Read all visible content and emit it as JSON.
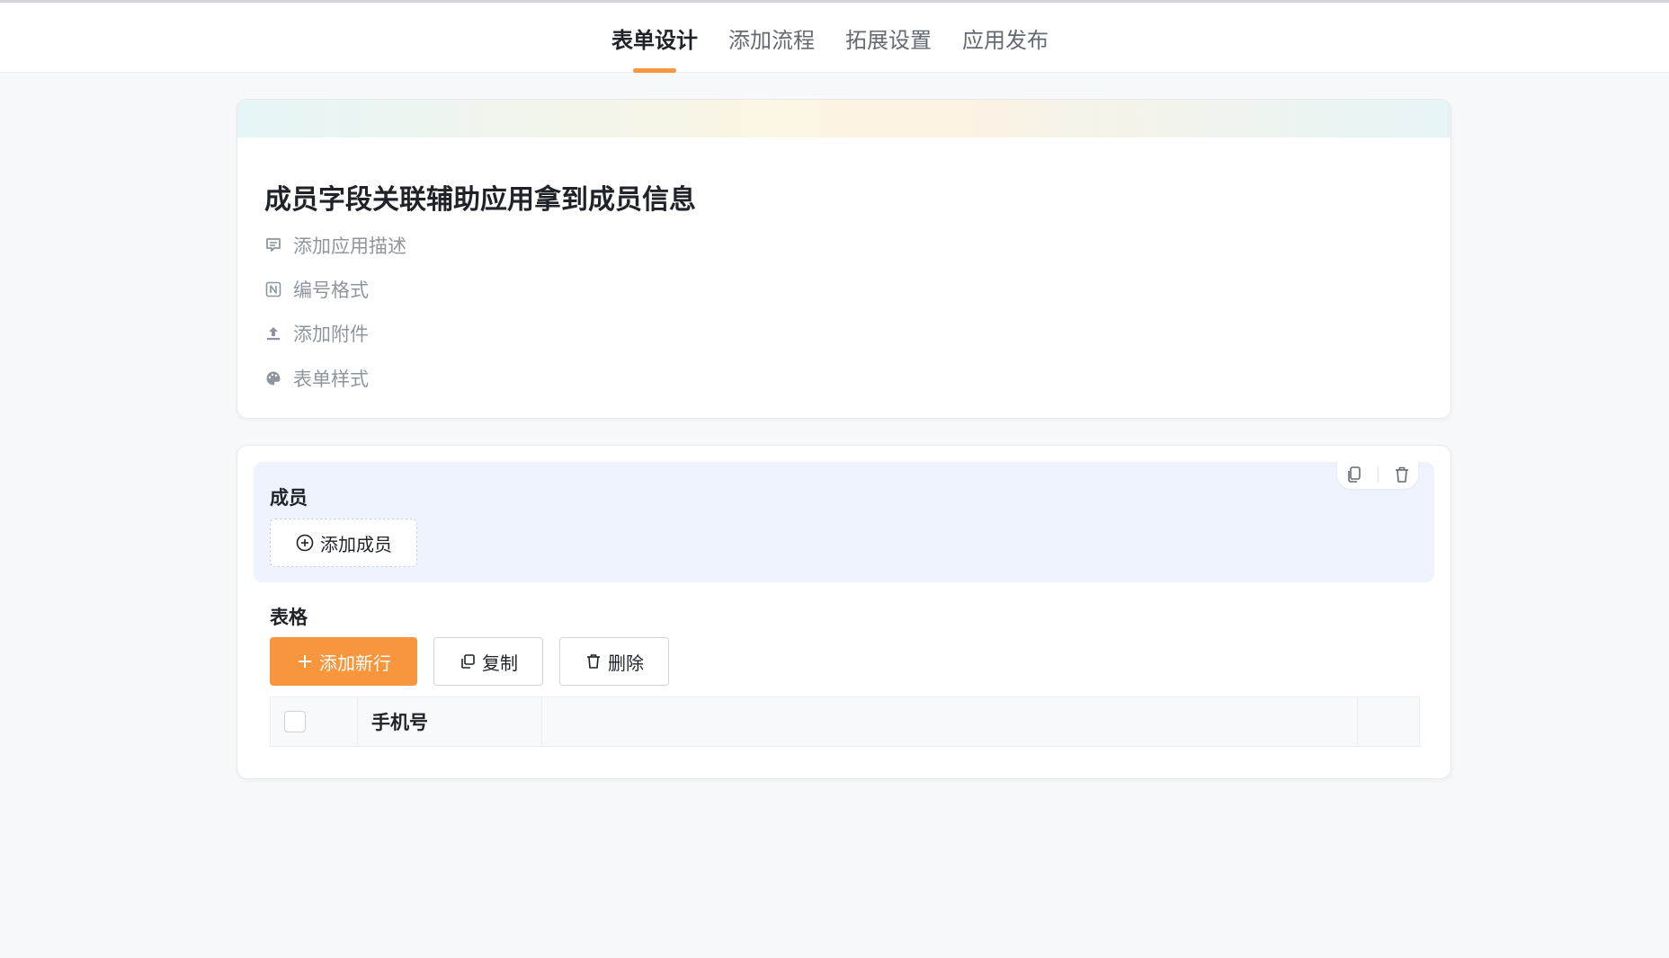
{
  "header": {
    "tabs": [
      {
        "label": "表单设计",
        "active": true
      },
      {
        "label": "添加流程",
        "active": false
      },
      {
        "label": "拓展设置",
        "active": false
      },
      {
        "label": "应用发布",
        "active": false
      }
    ]
  },
  "app": {
    "title": "成员字段关联辅助应用拿到成员信息",
    "options": [
      {
        "label": "添加应用描述",
        "icon": "comment-icon"
      },
      {
        "label": "编号格式",
        "icon": "number-format-icon"
      },
      {
        "label": "添加附件",
        "icon": "upload-icon"
      },
      {
        "label": "表单样式",
        "icon": "palette-icon"
      }
    ]
  },
  "form": {
    "member_field": {
      "label": "成员",
      "add_button": "添加成员"
    },
    "table_field": {
      "label": "表格",
      "add_row_button": "添加新行",
      "copy_button": "复制",
      "delete_button": "删除",
      "columns": [
        "手机号"
      ]
    }
  },
  "colors": {
    "accent": "#f7963c",
    "member_block_bg": "#eef3fd"
  }
}
